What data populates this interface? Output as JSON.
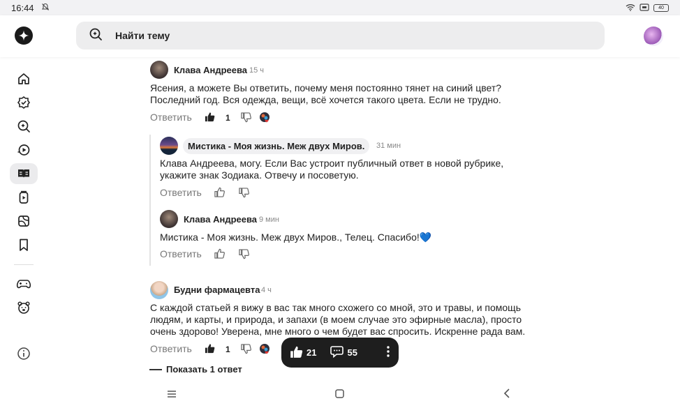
{
  "status": {
    "time": "16:44",
    "battery": "40"
  },
  "header": {
    "search_placeholder": "Найти тему"
  },
  "comments": [
    {
      "author": "Клава Андреева",
      "time": "15 ч",
      "text": "Ясения, а можете Вы ответить, почему меня постоянно тянет на синий цвет? Последний год. Вся одежда, вещи, всё хочется такого цвета. Если не трудно.",
      "reply_label": "Ответить",
      "likes": "1"
    },
    {
      "author": "Мистика - Моя жизнь. Меж двух Миров.",
      "time": "31 мин",
      "text": "Клава Андреева, могу. Если Вас устроит публичный ответ в новой рубрике, укажите знак Зодиака. Отвечу и посоветую.",
      "reply_label": "Ответить"
    },
    {
      "author": "Клава Андреева",
      "time": "9 мин",
      "text": "Мистика - Моя жизнь. Меж двух Миров., Телец. Спасибо!💙",
      "reply_label": "Ответить"
    },
    {
      "author": "Будни фармацевта",
      "time": "4 ч",
      "text": "С каждой статьей я вижу в вас так много схожего со мной, это и травы, и помощь людям, и карты, и природа, и запахи (в моем случае это эфирные масла), просто очень здорово! Уверена, мне много о чем будет вас спросить. Искренне рада вам.",
      "reply_label": "Ответить",
      "likes": "1"
    }
  ],
  "show_replies": "Показать 1 ответ",
  "floating_bar": {
    "likes": "21",
    "comments": "55"
  },
  "colors": {
    "accent_active": "#ebebed",
    "float_bg": "#1e1e1e",
    "search_bg": "#ededee"
  }
}
